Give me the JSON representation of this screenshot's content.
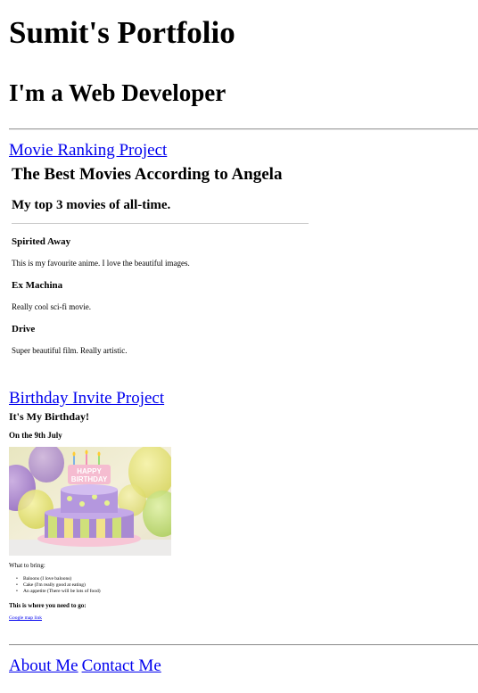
{
  "header": {
    "title": "Sumit's Portfolio",
    "subtitle": "I'm a Web Developer"
  },
  "projects": [
    {
      "link_text": "Movie Ranking Project",
      "preview": {
        "title": "The Best Movies According to Angela",
        "subtitle": "My top 3 movies of all-time.",
        "movies": [
          {
            "name": "Spirited Away",
            "desc": "This is my favourite anime. I love the beautiful images."
          },
          {
            "name": "Ex Machina",
            "desc": "Really cool sci-fi movie."
          },
          {
            "name": "Drive",
            "desc": "Super beautiful film. Really artistic."
          }
        ]
      }
    },
    {
      "link_text": "Birthday Invite Project",
      "preview": {
        "title": "It's My Birthday!",
        "date": "On the 9th July",
        "image_text": "HAPPY BIRTHDAY",
        "bring_heading": "What to bring:",
        "bring_items": [
          "Baloons (I love baloons)",
          "Cake (I'm really good at eating)",
          "An appetite (There will be lots of food)"
        ],
        "where_heading": "This is where you need to go:",
        "map_link": "Google map link"
      }
    }
  ],
  "footer": {
    "links": [
      "About Me",
      "Contact Me"
    ]
  },
  "colors": {
    "link": "#0000ee",
    "rule": "#9a9a9a"
  }
}
